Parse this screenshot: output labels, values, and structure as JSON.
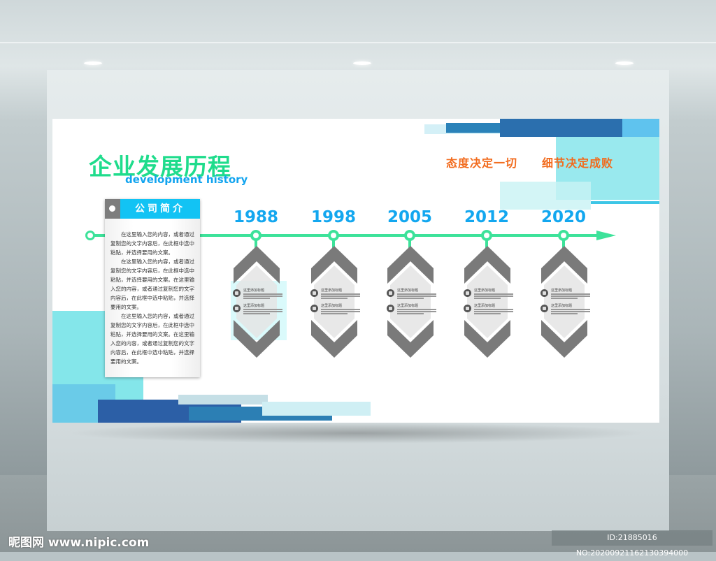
{
  "board": {
    "title": "企业发展历程",
    "subtitle": "development history",
    "slogans": [
      "态度决定一切",
      "细节决定成败"
    ],
    "panel": {
      "title": "公司简介",
      "paragraphs": [
        "在这里输入您的内容，或者通过复制您的文字内容后，在此框中选中粘贴，并选择要用的文案。",
        "在这里输入您的内容，或者通过复制您的文字内容后，在此框中选中粘贴，并选择要用的文案。在这里输入您的内容，或者通过复制您的文字内容后，在此框中选中粘贴，并选择要用的文案。",
        "在这里输入您的内容，或者通过复制您的文字内容后，在此框中选中粘贴，并选择要用的文案。在这里输入您的内容，或者通过复制您的文字内容后，在此框中选中粘贴，并选择要用的文案。"
      ]
    },
    "timeline": [
      {
        "year": "1988",
        "items": [
          "这里添加标题",
          "这里添加标题"
        ]
      },
      {
        "year": "1998",
        "items": [
          "这里添加标题",
          "这里添加标题"
        ]
      },
      {
        "year": "2005",
        "items": [
          "这里添加标题",
          "这里添加标题"
        ]
      },
      {
        "year": "2012",
        "items": [
          "这里添加标题",
          "这里添加标题"
        ]
      },
      {
        "year": "2020",
        "items": [
          "这里添加标题",
          "这里添加标题"
        ]
      }
    ],
    "icons": [
      "person-icon",
      "image-icon"
    ]
  },
  "watermark": {
    "site": "昵图网 www.nipic.com",
    "id": "ID:21885016 NO:20200921162130394000"
  },
  "colors": {
    "title": "#1fdc8c",
    "accent": "#13a7ef",
    "slogan": "#f26b1d",
    "chevron": "#7a7a7a"
  }
}
